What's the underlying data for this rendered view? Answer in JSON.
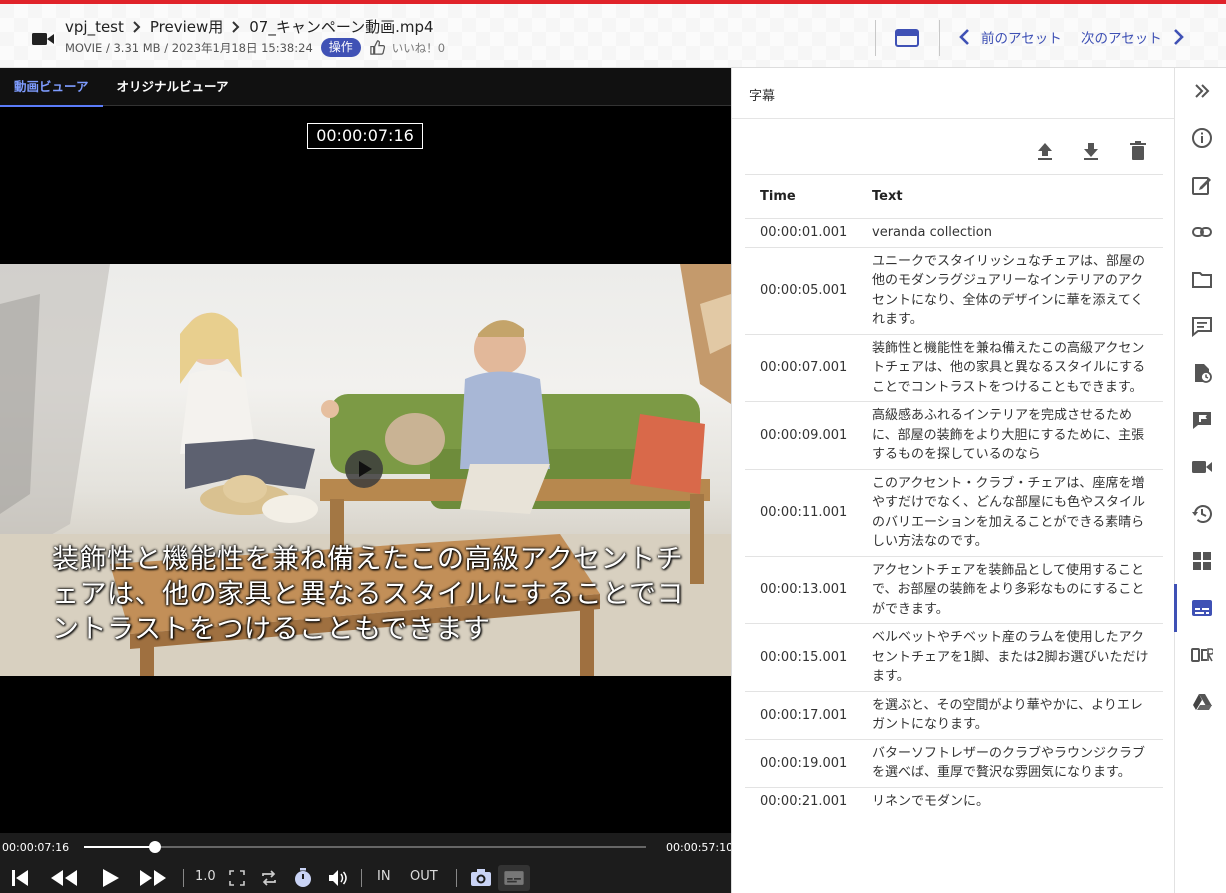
{
  "header": {
    "breadcrumb": [
      "vpj_test",
      "Preview用",
      "07_キャンペーン動画.mp4"
    ],
    "meta": "MOVIE / 3.31 MB / 2023年1月18日 15:38:24",
    "operation_label": "操作",
    "like_label": "いいね！0",
    "prev_asset_label": "前のアセット",
    "next_asset_label": "次のアセット",
    "accent_color": "#3f51b5",
    "brand_bar_color": "#e0232a"
  },
  "viewer": {
    "tabs": [
      {
        "label": "動画ビューア",
        "active": true
      },
      {
        "label": "オリジナルビューア",
        "active": false
      }
    ],
    "timecode": "00:00:07:16",
    "subtitle_line1": "装飾性と機能性を兼ね備えたこの高級アクセントチ",
    "subtitle_line2": "ェアは、他の家具と異なるスタイルにすることでコ",
    "subtitle_line3": "ントラストをつけることもできます",
    "controls": {
      "current_time": "00:00:07:16",
      "end_time": "00:00:57:10",
      "progress": 0.127,
      "speed": "1.0",
      "in_label": "IN",
      "out_label": "OUT"
    }
  },
  "subtitles_panel": {
    "title": "字幕",
    "columns": {
      "time": "Time",
      "text": "Text"
    },
    "rows": [
      {
        "time": "00:00:01.001",
        "text": "veranda collection"
      },
      {
        "time": "00:00:05.001",
        "text": "ユニークでスタイリッシュなチェアは、部屋の他のモダンラグジュアリーなインテリアのアクセントになり、全体のデザインに華を添えてくれます。"
      },
      {
        "time": "00:00:07.001",
        "text": "装飾性と機能性を兼ね備えたこの高級アクセントチェアは、他の家具と異なるスタイルにすることでコントラストをつけることもできます。"
      },
      {
        "time": "00:00:09.001",
        "text": "高級感あふれるインテリアを完成させるために、部屋の装飾をより大胆にするために、主張するものを探しているのなら"
      },
      {
        "time": "00:00:11.001",
        "text": "このアクセント・クラブ・チェアは、座席を増やすだけでなく、どんな部屋にも色やスタイルのバリエーションを加えることができる素晴らしい方法なのです。"
      },
      {
        "time": "00:00:13.001",
        "text": "アクセントチェアを装飾品として使用することで、お部屋の装飾をより多彩なものにすることができます。"
      },
      {
        "time": "00:00:15.001",
        "text": "ベルベットやチベット産のラムを使用したアクセントチェアを1脚、または2脚お選びいただけます。"
      },
      {
        "time": "00:00:17.001",
        "text": "を選ぶと、その空間がより華やかに、よりエレガントになります。"
      },
      {
        "time": "00:00:19.001",
        "text": "バターソフトレザーのクラブやラウンジクラブを選べば、重厚で贅沢な雰囲気になります。"
      },
      {
        "time": "00:00:21.001",
        "text": "リネンでモダンに。"
      }
    ]
  },
  "sidebar": {
    "icons": [
      "collapse-icon",
      "info-icon",
      "edit-icon",
      "link-icon",
      "folder-icon",
      "comment-icon",
      "file-history-icon",
      "review-icon",
      "video-icon",
      "history-icon",
      "grid-icon",
      "subtitles-icon",
      "ocr-icon",
      "drive-icon"
    ],
    "active": "subtitles-icon"
  }
}
